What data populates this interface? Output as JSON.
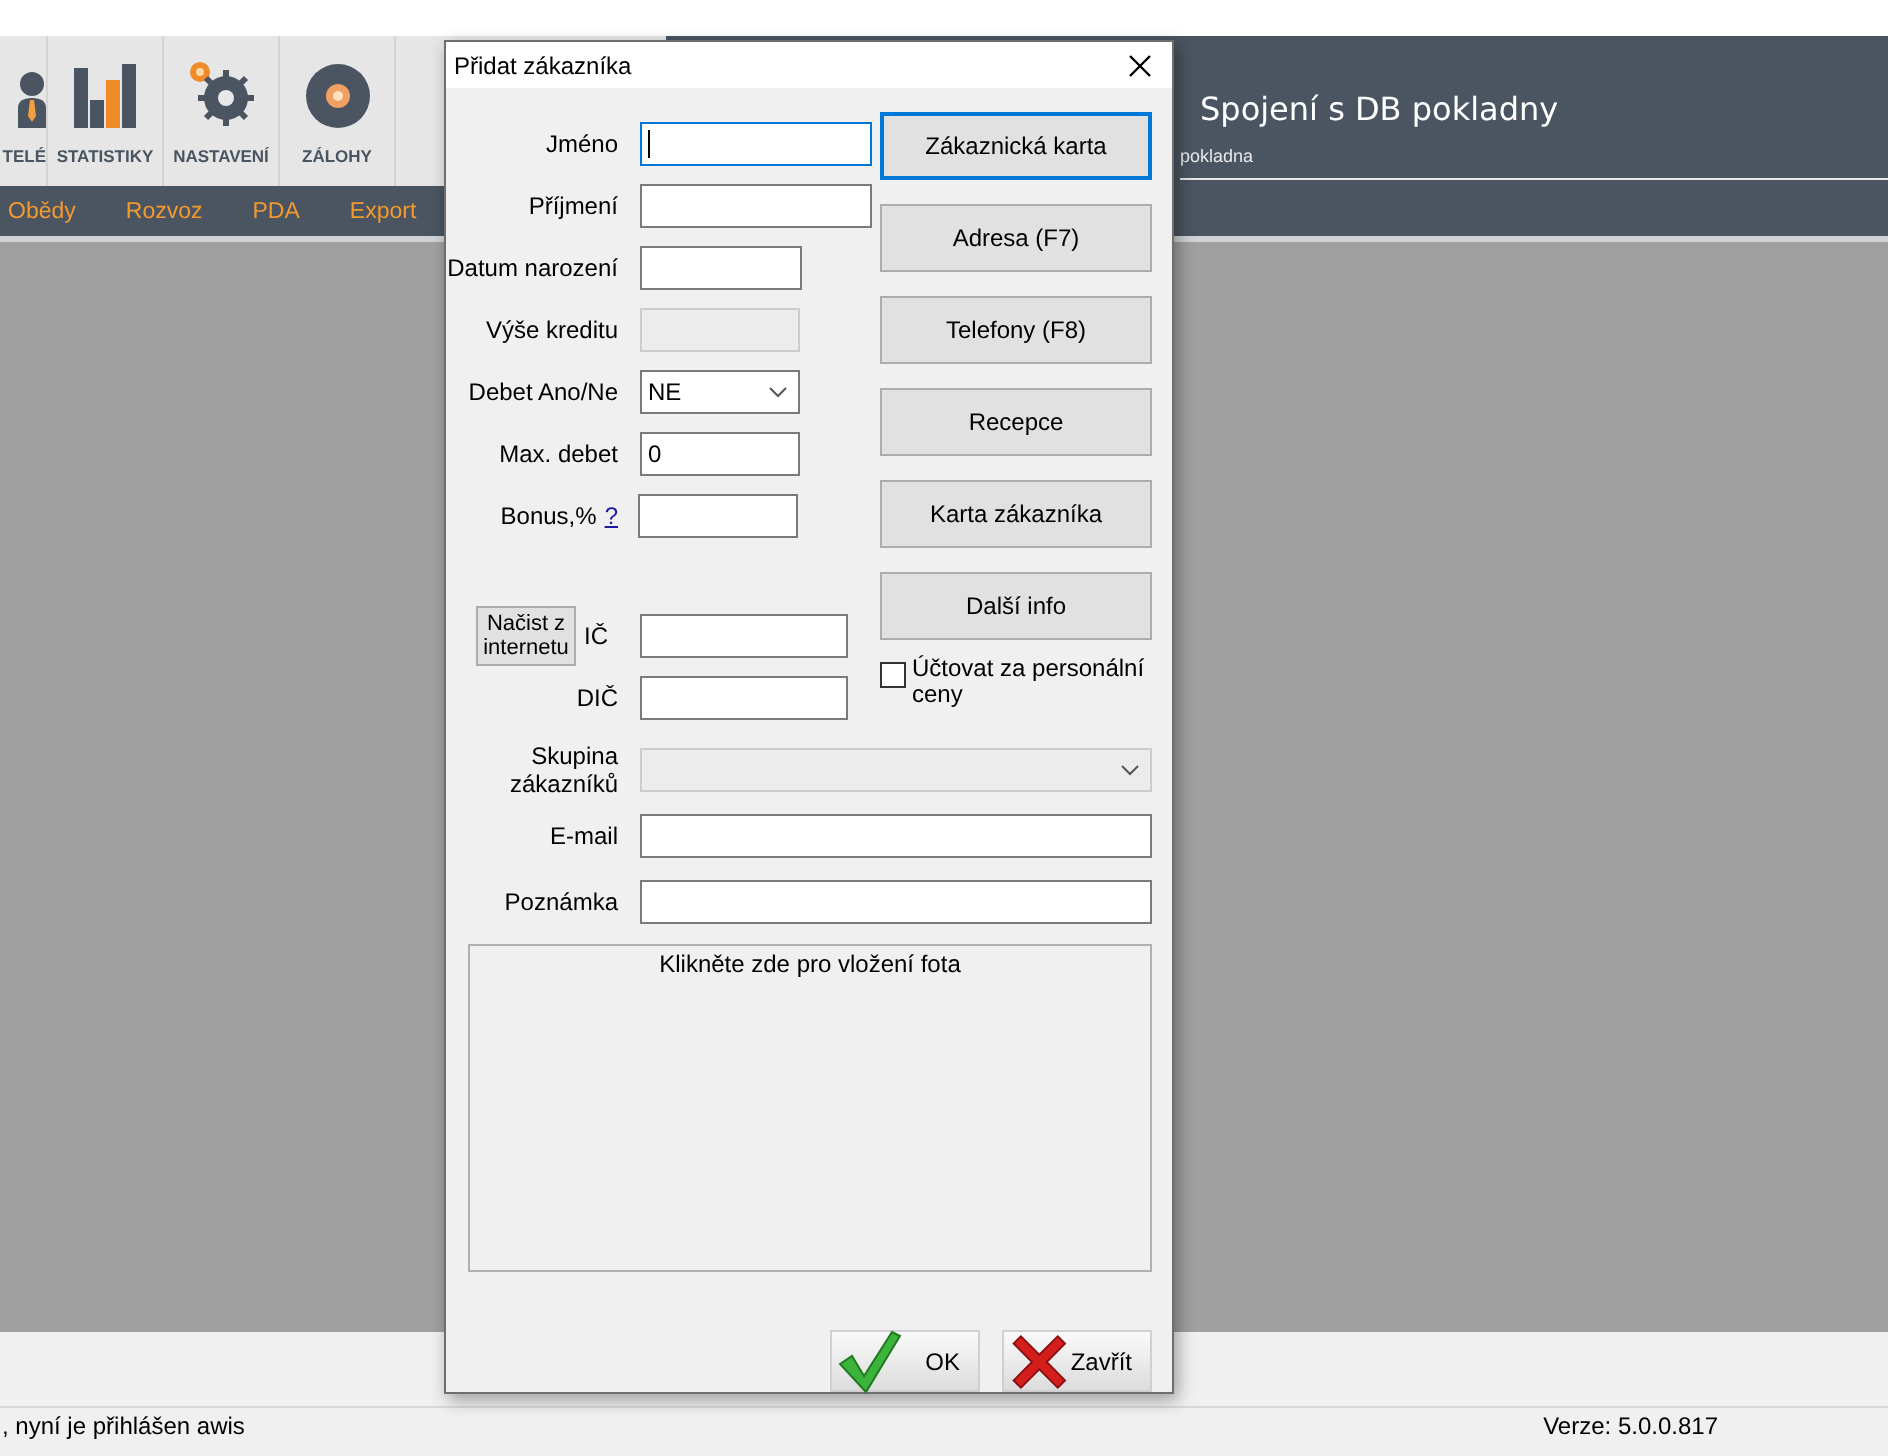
{
  "app": {
    "toolbar": [
      {
        "label": "TELÉ",
        "kind": "person"
      },
      {
        "label": "STATISTIKY",
        "kind": "chart"
      },
      {
        "label": "NASTAVENÍ",
        "kind": "gears"
      },
      {
        "label": "ZÁLOHY",
        "kind": "disc"
      }
    ],
    "menu": [
      "Obědy",
      "Rozvoz",
      "PDA",
      "Export"
    ],
    "header": {
      "title": "Spojení s DB pokladny",
      "subtitle": "pokladna"
    },
    "status_bar": {
      "message": ", nyní je přihlášen awis",
      "version": "Verze: 5.0.0.817"
    }
  },
  "dialog": {
    "title": "Přidat zákazníka",
    "fields": [
      {
        "label": "Jméno",
        "kind": "text",
        "focused": true,
        "disabled": false
      },
      {
        "label": "Příjmení",
        "kind": "text",
        "focused": false,
        "disabled": false
      },
      {
        "label": "Datum narození",
        "kind": "text",
        "focused": false,
        "disabled": false
      },
      {
        "label": "Výše kreditu",
        "kind": "text",
        "focused": false,
        "disabled": true
      },
      {
        "label": "Debet Ano/Ne",
        "kind": "select",
        "value": "NE",
        "focused": false,
        "disabled": false
      },
      {
        "label": "Max. debet",
        "kind": "text",
        "value": "0",
        "focused": false,
        "disabled": false
      },
      {
        "label": "Bonus,%",
        "kind": "help",
        "help": "?",
        "focused": false,
        "disabled": false
      },
      {
        "label": "IČ",
        "kind": "lookup",
        "button": "Načist z internetu",
        "focused": false,
        "disabled": false
      },
      {
        "label": "DIČ",
        "kind": "text",
        "focused": false,
        "disabled": false
      }
    ],
    "side_buttons": [
      {
        "label": "Zákaznická karta",
        "default": true
      },
      {
        "label": "Adresa (F7)",
        "default": false
      },
      {
        "label": "Telefony (F8)",
        "default": false
      },
      {
        "label": "Recepce",
        "default": false
      },
      {
        "label": "Karta zákazníka",
        "default": false
      },
      {
        "label": "Další info",
        "default": false
      }
    ],
    "checkbox": {
      "label": "Účtovat za personální ceny",
      "checked": false
    },
    "lower_fields": [
      {
        "label": "Skupina zákazníků",
        "kind": "select",
        "focused": false,
        "disabled": true
      },
      {
        "label": "E-mail",
        "kind": "text",
        "focused": false,
        "disabled": false
      },
      {
        "label": "Poznámka",
        "kind": "text",
        "focused": false,
        "disabled": false
      }
    ],
    "photo_hint": "Klikněte zde pro vložení fota",
    "actions": [
      {
        "label": "OK",
        "kind": "ok"
      },
      {
        "label": "Zavřít",
        "kind": "close"
      }
    ]
  }
}
